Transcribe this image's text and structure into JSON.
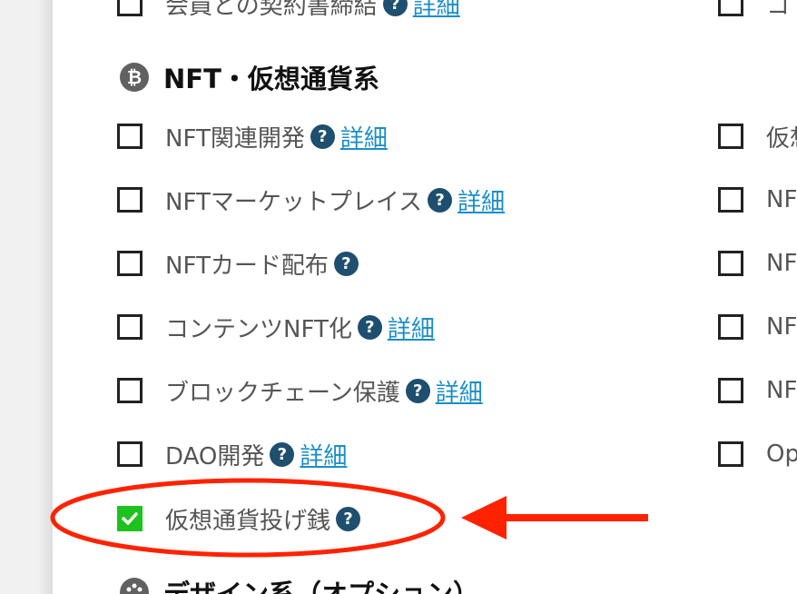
{
  "sections": {
    "nft_crypto": {
      "title": "NFT・仮想通貨系",
      "icon": "bitcoin-icon",
      "icon_glyph": "₿"
    },
    "design": {
      "title": "デザイン系（オプション）",
      "icon": "palette-icon"
    }
  },
  "top_row": {
    "left_label_partial": "会員との契約書締結",
    "right_label_partial": "コ"
  },
  "left_items": [
    {
      "label": "NFT関連開発",
      "checked": false,
      "has_detail": true
    },
    {
      "label": "NFTマーケットプレイス",
      "checked": false,
      "has_detail": true
    },
    {
      "label": "NFTカード配布",
      "checked": false,
      "has_detail": false
    },
    {
      "label": "コンテンツNFT化",
      "checked": false,
      "has_detail": true
    },
    {
      "label": "ブロックチェーン保護",
      "checked": false,
      "has_detail": true
    },
    {
      "label": "DAO開発",
      "checked": false,
      "has_detail": true
    },
    {
      "label": "仮想通貨投げ銭",
      "checked": true,
      "has_detail": false
    }
  ],
  "right_items": [
    {
      "label": "仮想"
    },
    {
      "label": "NF"
    },
    {
      "label": "NF"
    },
    {
      "label": "NF"
    },
    {
      "label": "NF"
    },
    {
      "label": "Op"
    }
  ],
  "help_glyph": "?",
  "detail_label": "詳細",
  "colors": {
    "check_green": "#1ec21e",
    "help_blue": "#1e4f6e",
    "link_blue": "#1a8ec7",
    "annotation_red": "#ff2200"
  }
}
